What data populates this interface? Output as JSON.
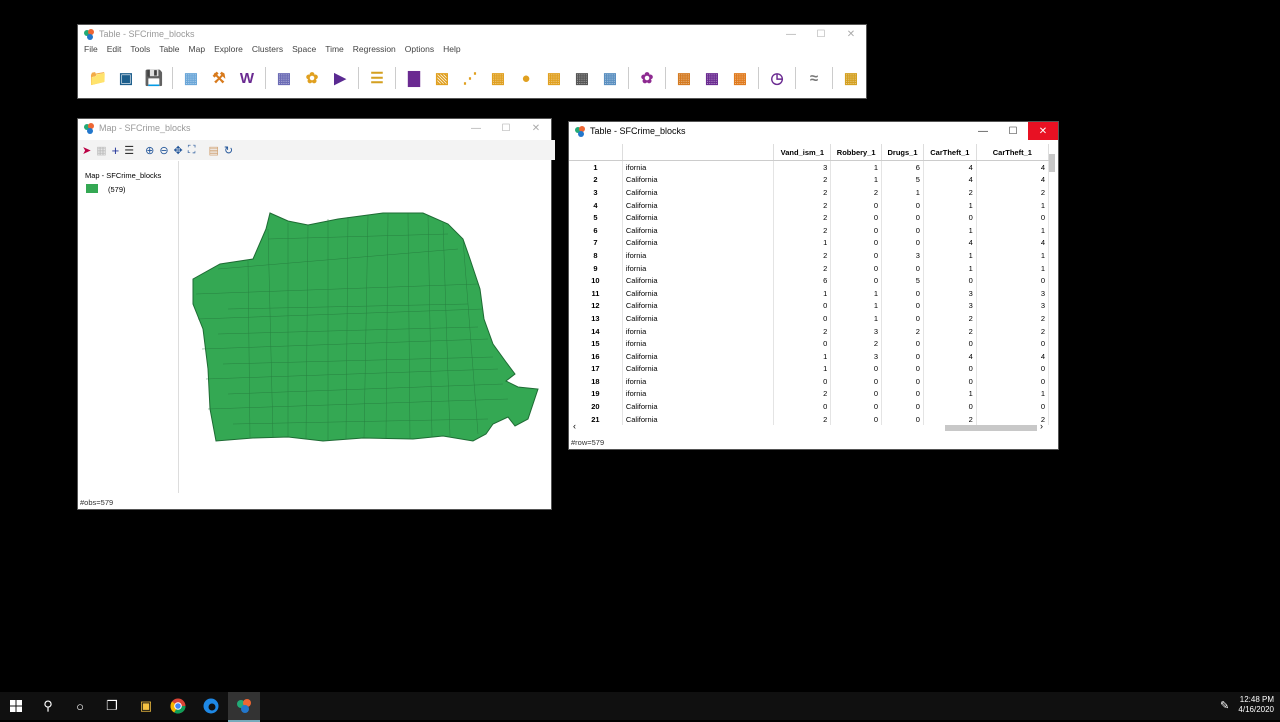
{
  "main_window": {
    "title": "Table - SFCrime_blocks",
    "menu": [
      "File",
      "Edit",
      "Tools",
      "Table",
      "Map",
      "Explore",
      "Clusters",
      "Space",
      "Time",
      "Regression",
      "Options",
      "Help"
    ],
    "toolbar_icons": [
      "open-folder-icon",
      "close-project-icon",
      "save-icon",
      "table-icon",
      "hammer-icon",
      "weights-icon",
      "connectivity-icon",
      "cartogram-icon",
      "play-icon",
      "sort-icon",
      "histogram-icon",
      "boxplot-icon",
      "scatter-icon",
      "scatter-matrix-icon",
      "bubble-icon",
      "3d-icon",
      "pcp-icon",
      "conditional-icon",
      "cluster-icon",
      "correlogram-icon",
      "averages-icon",
      "lisa-icon",
      "time-icon",
      "trend-icon",
      "regression-icon"
    ]
  },
  "map_window": {
    "title": "Map - SFCrime_blocks",
    "legend_title": "Map - SFCrime_blocks",
    "legend_count": "(579)",
    "fill_color": "#34a853",
    "status": "#obs=579"
  },
  "table_window": {
    "title": "Table - SFCrime_blocks",
    "columns": [
      "Vand_ism_1",
      "Robbery_1",
      "Drugs_1",
      "CarTheft_1",
      "CarTheft_1"
    ],
    "rows": [
      {
        "id": "1",
        "name": "ifornia",
        "v": [
          "3",
          "1",
          "6",
          "4",
          "4"
        ]
      },
      {
        "id": "2",
        "name": "California",
        "v": [
          "2",
          "1",
          "5",
          "4",
          "4"
        ]
      },
      {
        "id": "3",
        "name": "California",
        "v": [
          "2",
          "2",
          "1",
          "2",
          "2"
        ]
      },
      {
        "id": "4",
        "name": "California",
        "v": [
          "2",
          "0",
          "0",
          "1",
          "1"
        ]
      },
      {
        "id": "5",
        "name": "California",
        "v": [
          "2",
          "0",
          "0",
          "0",
          "0"
        ]
      },
      {
        "id": "6",
        "name": "California",
        "v": [
          "2",
          "0",
          "0",
          "1",
          "1"
        ]
      },
      {
        "id": "7",
        "name": "California",
        "v": [
          "1",
          "0",
          "0",
          "4",
          "4"
        ]
      },
      {
        "id": "8",
        "name": "ifornia",
        "v": [
          "2",
          "0",
          "3",
          "1",
          "1"
        ]
      },
      {
        "id": "9",
        "name": "ifornia",
        "v": [
          "2",
          "0",
          "0",
          "1",
          "1"
        ]
      },
      {
        "id": "10",
        "name": "California",
        "v": [
          "6",
          "0",
          "5",
          "0",
          "0"
        ]
      },
      {
        "id": "11",
        "name": "California",
        "v": [
          "1",
          "1",
          "0",
          "3",
          "3"
        ]
      },
      {
        "id": "12",
        "name": "California",
        "v": [
          "0",
          "1",
          "0",
          "3",
          "3"
        ]
      },
      {
        "id": "13",
        "name": "California",
        "v": [
          "0",
          "1",
          "0",
          "2",
          "2"
        ]
      },
      {
        "id": "14",
        "name": "ifornia",
        "v": [
          "2",
          "3",
          "2",
          "2",
          "2"
        ]
      },
      {
        "id": "15",
        "name": "ifornia",
        "v": [
          "0",
          "2",
          "0",
          "0",
          "0"
        ]
      },
      {
        "id": "16",
        "name": "California",
        "v": [
          "1",
          "3",
          "0",
          "4",
          "4"
        ]
      },
      {
        "id": "17",
        "name": "California",
        "v": [
          "1",
          "0",
          "0",
          "0",
          "0"
        ]
      },
      {
        "id": "18",
        "name": "ifornia",
        "v": [
          "0",
          "0",
          "0",
          "0",
          "0"
        ]
      },
      {
        "id": "19",
        "name": "ifornia",
        "v": [
          "2",
          "0",
          "0",
          "1",
          "1"
        ]
      },
      {
        "id": "20",
        "name": "California",
        "v": [
          "0",
          "0",
          "0",
          "0",
          "0"
        ]
      },
      {
        "id": "21",
        "name": "California",
        "v": [
          "2",
          "0",
          "0",
          "2",
          "2"
        ]
      }
    ],
    "status": "#row=579"
  },
  "taskbar": {
    "time": "12:48 PM",
    "date": "4/16/2020"
  }
}
